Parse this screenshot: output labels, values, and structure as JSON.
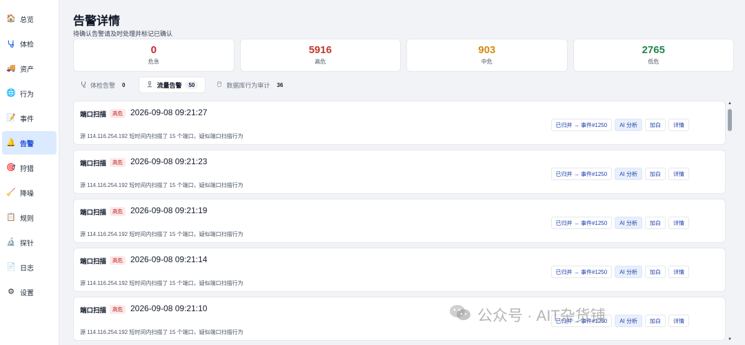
{
  "sidebar": {
    "items": [
      {
        "label": "总览",
        "icon": "house-icon",
        "glyph": "🏠",
        "active": false
      },
      {
        "label": "体检",
        "icon": "stethoscope-icon",
        "glyph": "",
        "active": false
      },
      {
        "label": "资产",
        "icon": "truck-icon",
        "glyph": "🚚",
        "active": false
      },
      {
        "label": "行为",
        "icon": "globe-icon",
        "glyph": "🌐",
        "active": false
      },
      {
        "label": "事件",
        "icon": "memo-icon",
        "glyph": "📝",
        "active": false
      },
      {
        "label": "告警",
        "icon": "bell-icon",
        "glyph": "🔔",
        "active": true
      },
      {
        "label": "狩猎",
        "icon": "target-icon",
        "glyph": "🎯",
        "active": false
      },
      {
        "label": "降噪",
        "icon": "broom-icon",
        "glyph": "🧹",
        "active": false
      },
      {
        "label": "规则",
        "icon": "clipboard-icon",
        "glyph": "📋",
        "active": false
      },
      {
        "label": "探针",
        "icon": "microscope-icon",
        "glyph": "🔬",
        "active": false
      },
      {
        "label": "日志",
        "icon": "document-icon",
        "glyph": "📄",
        "active": false
      },
      {
        "label": "设置",
        "icon": "gear-icon",
        "glyph": "⚙",
        "active": false
      }
    ]
  },
  "header": {
    "title": "告警详情",
    "subtitle": "待确认告警请及时处理并标记已确认"
  },
  "stats": [
    {
      "value": "0",
      "label": "危急",
      "color": "#c62828"
    },
    {
      "value": "5916",
      "label": "高危",
      "color": "#c0392b"
    },
    {
      "value": "903",
      "label": "中危",
      "color": "#d68910"
    },
    {
      "value": "2765",
      "label": "低危",
      "color": "#1e8449"
    }
  ],
  "tabs": [
    {
      "label": "体检告警",
      "count": "0",
      "icon": "stethoscope-icon",
      "active": false
    },
    {
      "label": "流量告警",
      "count": "50",
      "icon": "microscope-icon",
      "active": true
    },
    {
      "label": "数据库行为审计",
      "count": "36",
      "icon": "database-icon",
      "active": false
    }
  ],
  "alerts": [
    {
      "title": "端口扫描",
      "severity": "高危",
      "time": "2026-09-08 09:21:27",
      "description": "源 114.116.254.192 短时间内扫描了 15 个端口，疑似端口扫描行为",
      "merged": "已归并 → 事件#1250",
      "ai": "AI 分析",
      "whitelist": "加白",
      "detail": "详情"
    },
    {
      "title": "端口扫描",
      "severity": "高危",
      "time": "2026-09-08 09:21:23",
      "description": "源 114.116.254.192 短时间内扫描了 15 个端口，疑似端口扫描行为",
      "merged": "已归并 → 事件#1250",
      "ai": "AI 分析",
      "whitelist": "加白",
      "detail": "详情"
    },
    {
      "title": "端口扫描",
      "severity": "高危",
      "time": "2026-09-08 09:21:19",
      "description": "源 114.116.254.192 短时间内扫描了 15 个端口，疑似端口扫描行为",
      "merged": "已归并 → 事件#1250",
      "ai": "AI 分析",
      "whitelist": "加白",
      "detail": "详情"
    },
    {
      "title": "端口扫描",
      "severity": "高危",
      "time": "2026-09-08 09:21:14",
      "description": "源 114.116.254.192 短时间内扫描了 15 个端口，疑似端口扫描行为",
      "merged": "已归并 → 事件#1250",
      "ai": "AI 分析",
      "whitelist": "加白",
      "detail": "详情"
    },
    {
      "title": "端口扫描",
      "severity": "高危",
      "time": "2026-09-08 09:21:10",
      "description": "源 114.116.254.192 短时间内扫描了 15 个端口，疑似端口扫描行为",
      "merged": "已归并 → 事件#1250",
      "ai": "AI 分析",
      "whitelist": "加白",
      "detail": "详情"
    }
  ],
  "watermark": {
    "text": "公众号 · AIT杂货铺",
    "icon": "wechat-icon"
  }
}
